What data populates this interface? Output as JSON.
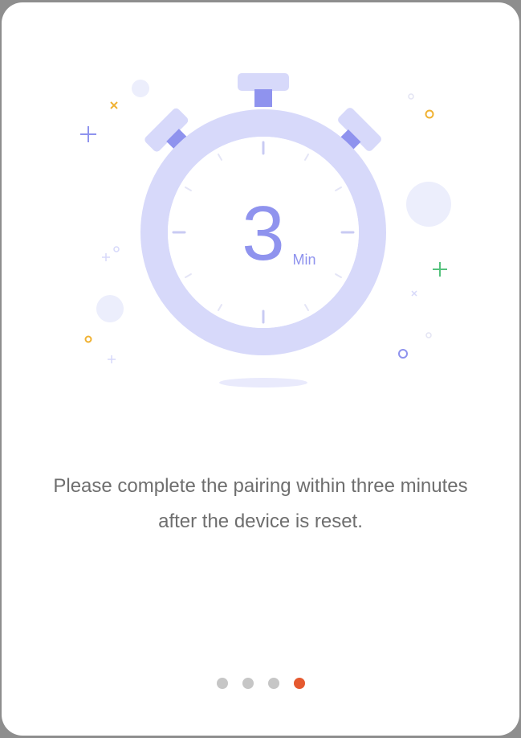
{
  "timer": {
    "value": "3",
    "unit": "Min"
  },
  "message": {
    "line1": "Please complete the pairing within three minutes",
    "line2": "after the device is reset."
  },
  "pager": {
    "total": 4,
    "active_index": 3,
    "inactive_color": "#c6c6c6",
    "active_color": "#e5592f"
  },
  "colors": {
    "accent": "#8f93ee",
    "accent_light": "#d7d9fa",
    "accent_pale": "#e9eafc",
    "yellow": "#f0b233",
    "green": "#55c27d",
    "text": "#6e6e6e"
  }
}
